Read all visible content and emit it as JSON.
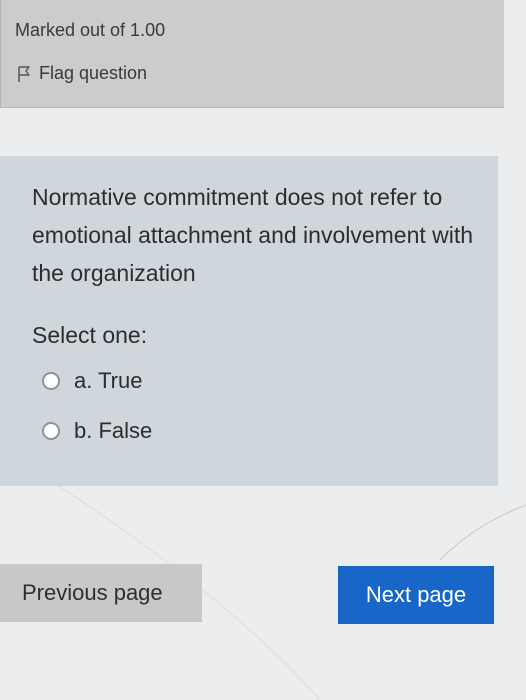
{
  "info": {
    "marks": "Marked out of 1.00",
    "flag_label": "Flag question"
  },
  "question": {
    "text": "Normative commitment does not refer to emotional attachment and involvement with the organization",
    "prompt": "Select one:",
    "options": [
      {
        "label": "a. True",
        "selected": false
      },
      {
        "label": "b. False",
        "selected": false
      }
    ]
  },
  "navigation": {
    "previous_label": "Previous page",
    "next_label": "Next page"
  },
  "icons": {
    "flag": "flag-icon",
    "radio": "radio-empty-icon"
  },
  "colors": {
    "info_background": "#cbcccd",
    "question_background": "#cfd7dc",
    "page_background": "#ecedee",
    "next_button": "#1966c9",
    "previous_button": "#c7c8c9"
  }
}
